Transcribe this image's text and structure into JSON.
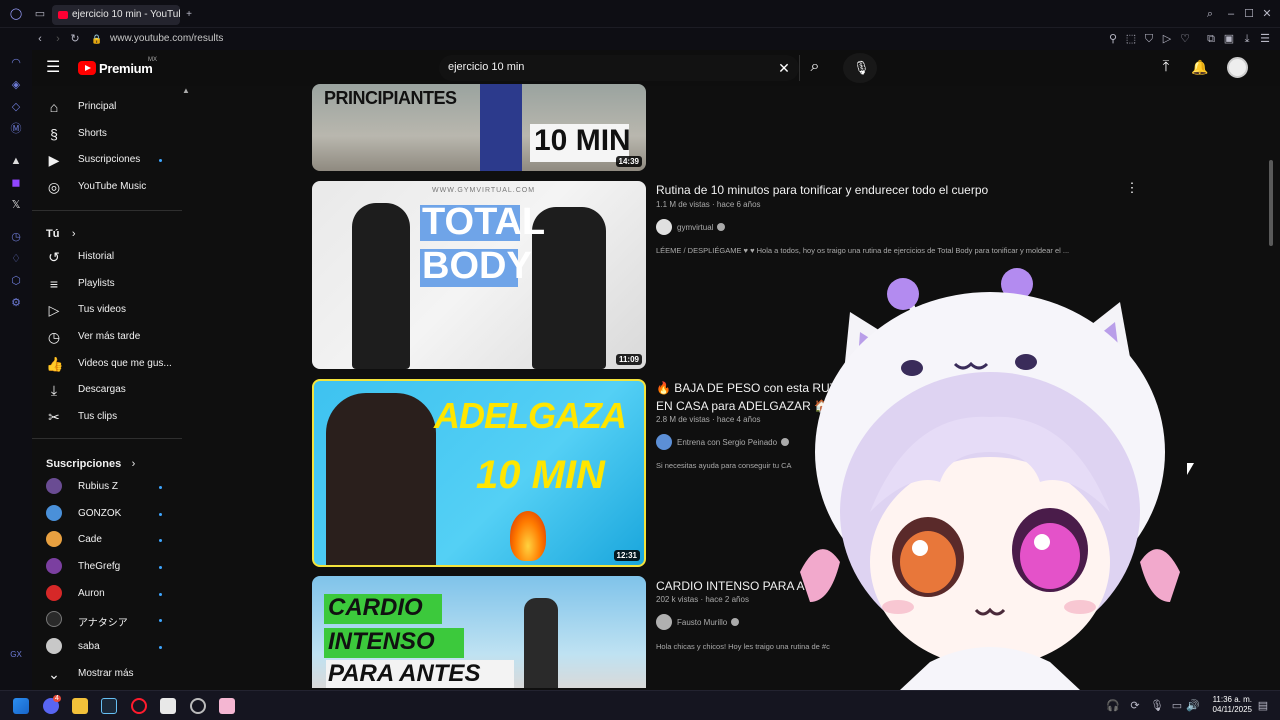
{
  "browser": {
    "tab_title": "ejercicio 10 min - YouTube",
    "url": "www.youtube.com/results"
  },
  "header": {
    "logo_text": "Premium",
    "logo_region": "MX",
    "search_query": "ejercicio 10 min"
  },
  "sidebar": {
    "main": [
      {
        "label": "Principal",
        "icon": "home-icon"
      },
      {
        "label": "Shorts",
        "icon": "shorts-icon"
      },
      {
        "label": "Suscripciones",
        "icon": "subscriptions-icon"
      },
      {
        "label": "YouTube Music",
        "icon": "music-icon"
      }
    ],
    "you_heading": "Tú",
    "you": [
      {
        "label": "Historial",
        "icon": "history-icon"
      },
      {
        "label": "Playlists",
        "icon": "playlists-icon"
      },
      {
        "label": "Tus videos",
        "icon": "your-videos-icon"
      },
      {
        "label": "Ver más tarde",
        "icon": "watch-later-icon"
      },
      {
        "label": "Videos que me gus...",
        "icon": "like-icon"
      },
      {
        "label": "Descargas",
        "icon": "download-icon"
      },
      {
        "label": "Tus clips",
        "icon": "clips-icon"
      }
    ],
    "subs_heading": "Suscripciones",
    "subs": [
      {
        "label": "Rubius Z",
        "color": "#6a4c93"
      },
      {
        "label": "GONZOK",
        "color": "#4a90d9"
      },
      {
        "label": "Cade",
        "color": "#e8a040"
      },
      {
        "label": "TheGrefg",
        "color": "#7b3fa0"
      },
      {
        "label": "Auron",
        "color": "#d62828"
      },
      {
        "label": "アナタシア",
        "color": "#2a2a2a"
      },
      {
        "label": "saba",
        "color": "#c8c8c8"
      }
    ],
    "more_label": "Mostrar más"
  },
  "results": [
    {
      "thumb_text_top": "PRINCIPIANTES",
      "thumb_text_big": "10 MIN",
      "duration": "14:39",
      "title": "",
      "views": "",
      "age": "",
      "channel": "",
      "description": ""
    },
    {
      "thumb_text_top": "TOTAL",
      "thumb_text_big": "BODY",
      "thumb_watermark": "WWW.GYMVIRTUAL.COM",
      "duration": "11:09",
      "title": "Rutina de 10 minutos para tonificar y endurecer todo el cuerpo",
      "views": "1.1 M de vistas",
      "age": "hace 6 años",
      "channel": "gymvirtual",
      "description": "LÉEME / DESPLIÉGAME ♥ ♥ Hola a todos, hoy os traigo una rutina de ejercicios de Total Body para tonificar y moldear el ..."
    },
    {
      "thumb_text_top": "ADELGAZA",
      "thumb_text_big": "10 MIN",
      "duration": "12:31",
      "title_line1": "🔥 BAJA DE PESO con esta RUTI",
      "title_line2": "EN CASA para ADELGAZAR 🏠",
      "views": "2.8 M de vistas",
      "age": "hace 4 años",
      "channel": "Entrena con Sergio Peinado",
      "description": "Si necesitas ayuda para conseguir tu CA"
    },
    {
      "thumb_text_top": "CARDIO",
      "thumb_text_mid": "INTENSO",
      "thumb_text_big": "PARA ANTES",
      "title": "CARDIO INTENSO PARA A",
      "views": "202 k vistas",
      "age": "hace 2 años",
      "channel": "Fausto Murillo",
      "description": "Hola chicas y chicos! Hoy les traigo una rutina de #c"
    }
  ],
  "taskbar": {
    "time": "11:36 a. m.",
    "date": "04/11/2025",
    "discord_badge": "4"
  },
  "colors": {
    "accent": "#3ea6ff",
    "youtube_red": "#ff0000",
    "background": "#0f0f0f"
  }
}
